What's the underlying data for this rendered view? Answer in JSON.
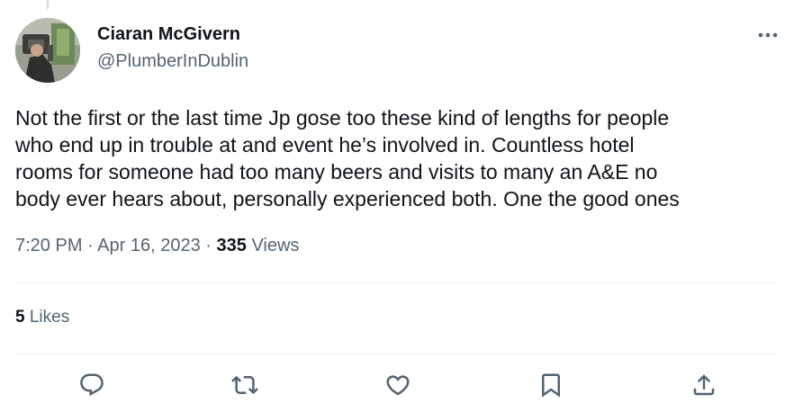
{
  "author": {
    "name": "Ciaran McGivern",
    "handle": "@PlumberInDublin"
  },
  "tweet": {
    "text": "Not the first or the last time Jp gose too these kind of lengths for people\nwho end up in trouble at and event he’s involved in. Countless hotel\nrooms for someone had too many beers and visits to many an A&E no\nbody ever hears about, personally experienced both. One the good ones",
    "time": "7:20 PM",
    "separator": "·",
    "date": "Apr 16, 2023",
    "views_count": "335",
    "views_label": "Views"
  },
  "engagement": {
    "likes_count": "5",
    "likes_label": "Likes"
  },
  "icons": {
    "more": "more-horizontal-icon",
    "reply": "reply-bubble-icon",
    "retweet": "retweet-icon",
    "like": "heart-icon",
    "bookmark": "bookmark-icon",
    "share": "share-upload-icon"
  },
  "colors": {
    "text_primary": "#0f1419",
    "text_secondary": "#536471",
    "divider": "#eff3f4"
  }
}
